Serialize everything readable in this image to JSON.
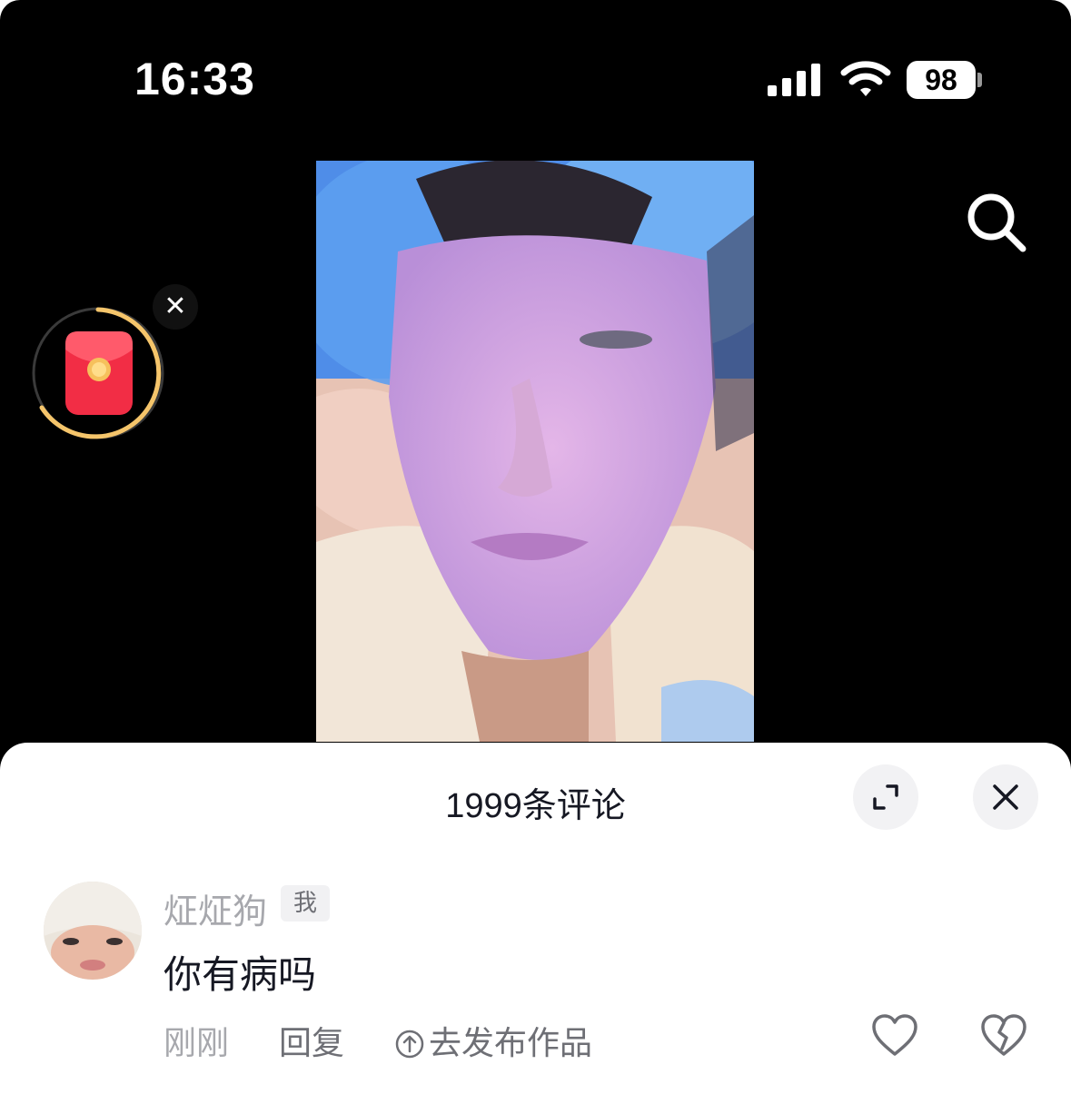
{
  "status_bar": {
    "time": "16:33",
    "battery": "98"
  },
  "video": {
    "search_icon": "search-icon",
    "red_packet_icon": "red-envelope-icon",
    "close_icon": "close-icon",
    "accent_ring_color": "#f5c56b"
  },
  "comments_sheet": {
    "title": "1999条评论",
    "expand_icon": "expand-icon",
    "close_icon": "close-icon",
    "comment": {
      "username": "炡炡狗",
      "badge": "我",
      "text": "你有病吗",
      "time": "刚刚",
      "reply_label": "回复",
      "publish_label": "去发布作品",
      "like_icon": "heart-icon",
      "dislike_icon": "broken-heart-icon"
    }
  }
}
